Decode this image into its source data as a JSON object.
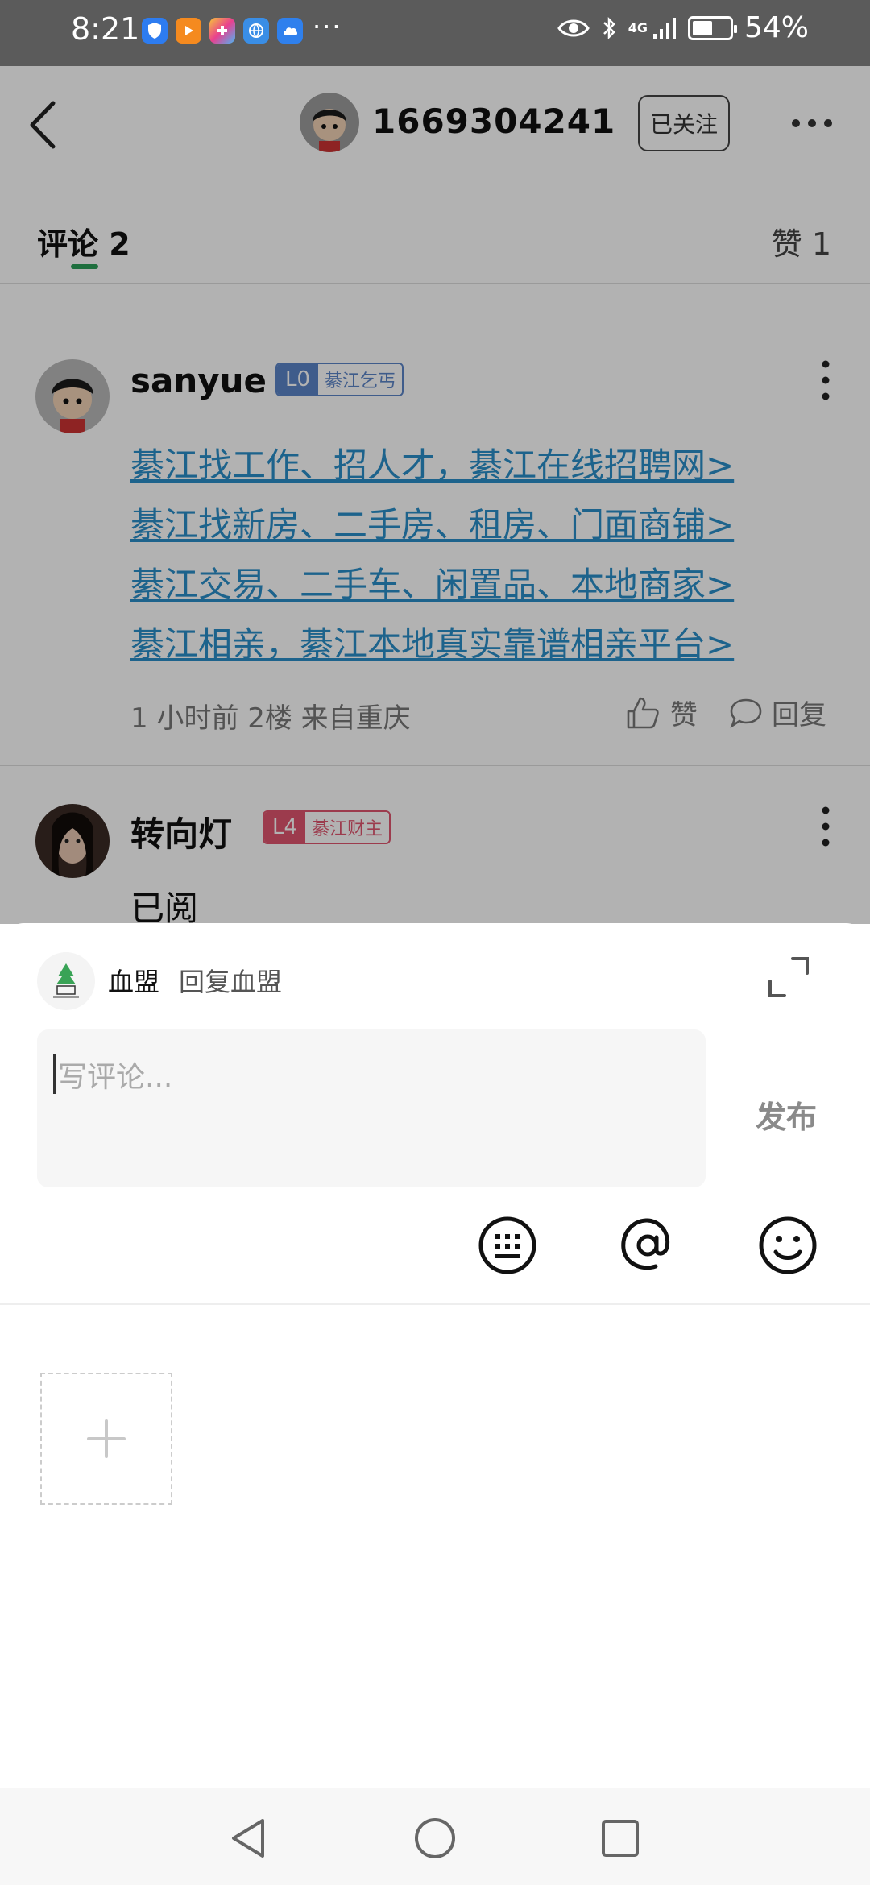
{
  "status_bar": {
    "time": "8:21",
    "dots": "···",
    "network": "4G",
    "battery": "54%",
    "battery_level": 0.54
  },
  "header": {
    "user_id": "1669304241",
    "follow_label": "已关注"
  },
  "tabs": {
    "comments_label": "评论 2",
    "likes_label": "赞 1"
  },
  "comments": [
    {
      "name": "sanyue",
      "level": "L0",
      "title": "綦江乞丐",
      "links": [
        "綦江找工作、招人才，綦江在线招聘网>",
        "綦江找新房、二手房、租房、门面商铺>",
        "綦江交易、二手车、闲置品、本地商家>",
        "綦江相亲，綦江本地真实靠谱相亲平台>"
      ],
      "meta": "1 小时前  2楼  来自重庆",
      "like_label": "赞",
      "reply_label": "回复"
    },
    {
      "name": "转向灯",
      "level": "L4",
      "title": "綦江财主",
      "body": "已阅"
    }
  ],
  "reply_sheet": {
    "name": "血盟",
    "reply_to": "回复血盟",
    "placeholder": "写评论...",
    "publish_label": "发布"
  },
  "colors": {
    "link": "#2a8fc9",
    "accent": "#2ca05a",
    "badge_l0": "#5b84c8",
    "badge_l4": "#e0556f"
  }
}
